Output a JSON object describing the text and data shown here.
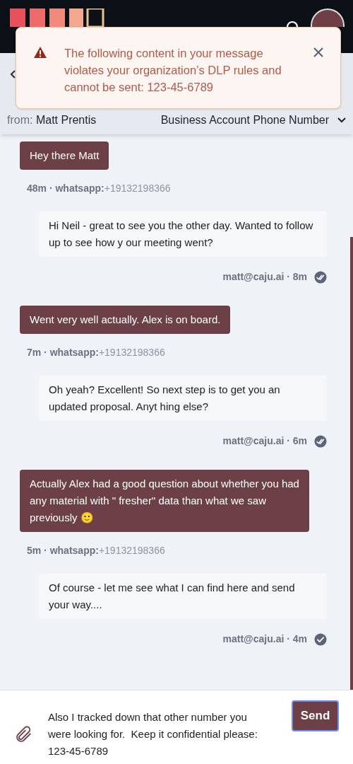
{
  "alert": {
    "message": "The following content in your message violates your organization’s DLP rules and cannot be sent: 123-45-6789"
  },
  "conversation": {
    "from_label": "from:",
    "from_name": "Matt Prentis",
    "channel": "Business Account Phone Number"
  },
  "messages": [
    {
      "kind": "incoming",
      "text": "Hey there Matt",
      "meta": "48m · whatsapp:",
      "number": "+19132198366"
    },
    {
      "kind": "outgoing",
      "text": "Hi Neil - great to see you the other day. Wanted to follow up to see how y our meeting went?",
      "meta": "matt@caju.ai · 8m",
      "read": true
    },
    {
      "kind": "incoming",
      "text": "Went very well actually. Alex is on board.",
      "meta": "7m · whatsapp:",
      "number": "+19132198366"
    },
    {
      "kind": "outgoing",
      "text": "Oh yeah? Excellent! So next step is to get you an updated proposal. Anyt hing else?",
      "meta": "matt@caju.ai · 6m",
      "read": true
    },
    {
      "kind": "incoming",
      "text": "Actually Alex had a good question about whether you had any material with \" fresher\" data than what we saw previously 🙂",
      "meta": "5m · whatsapp:",
      "number": "+19132198366"
    },
    {
      "kind": "outgoing",
      "text": "Of course - let me see what I can find here and send your way....",
      "meta": "matt@caju.ai · 4m",
      "read": false
    }
  ],
  "composer": {
    "value": "Also I tracked down that other number you were looking for.  Keep it confidential please:  123-45-6789",
    "send": "Send"
  }
}
